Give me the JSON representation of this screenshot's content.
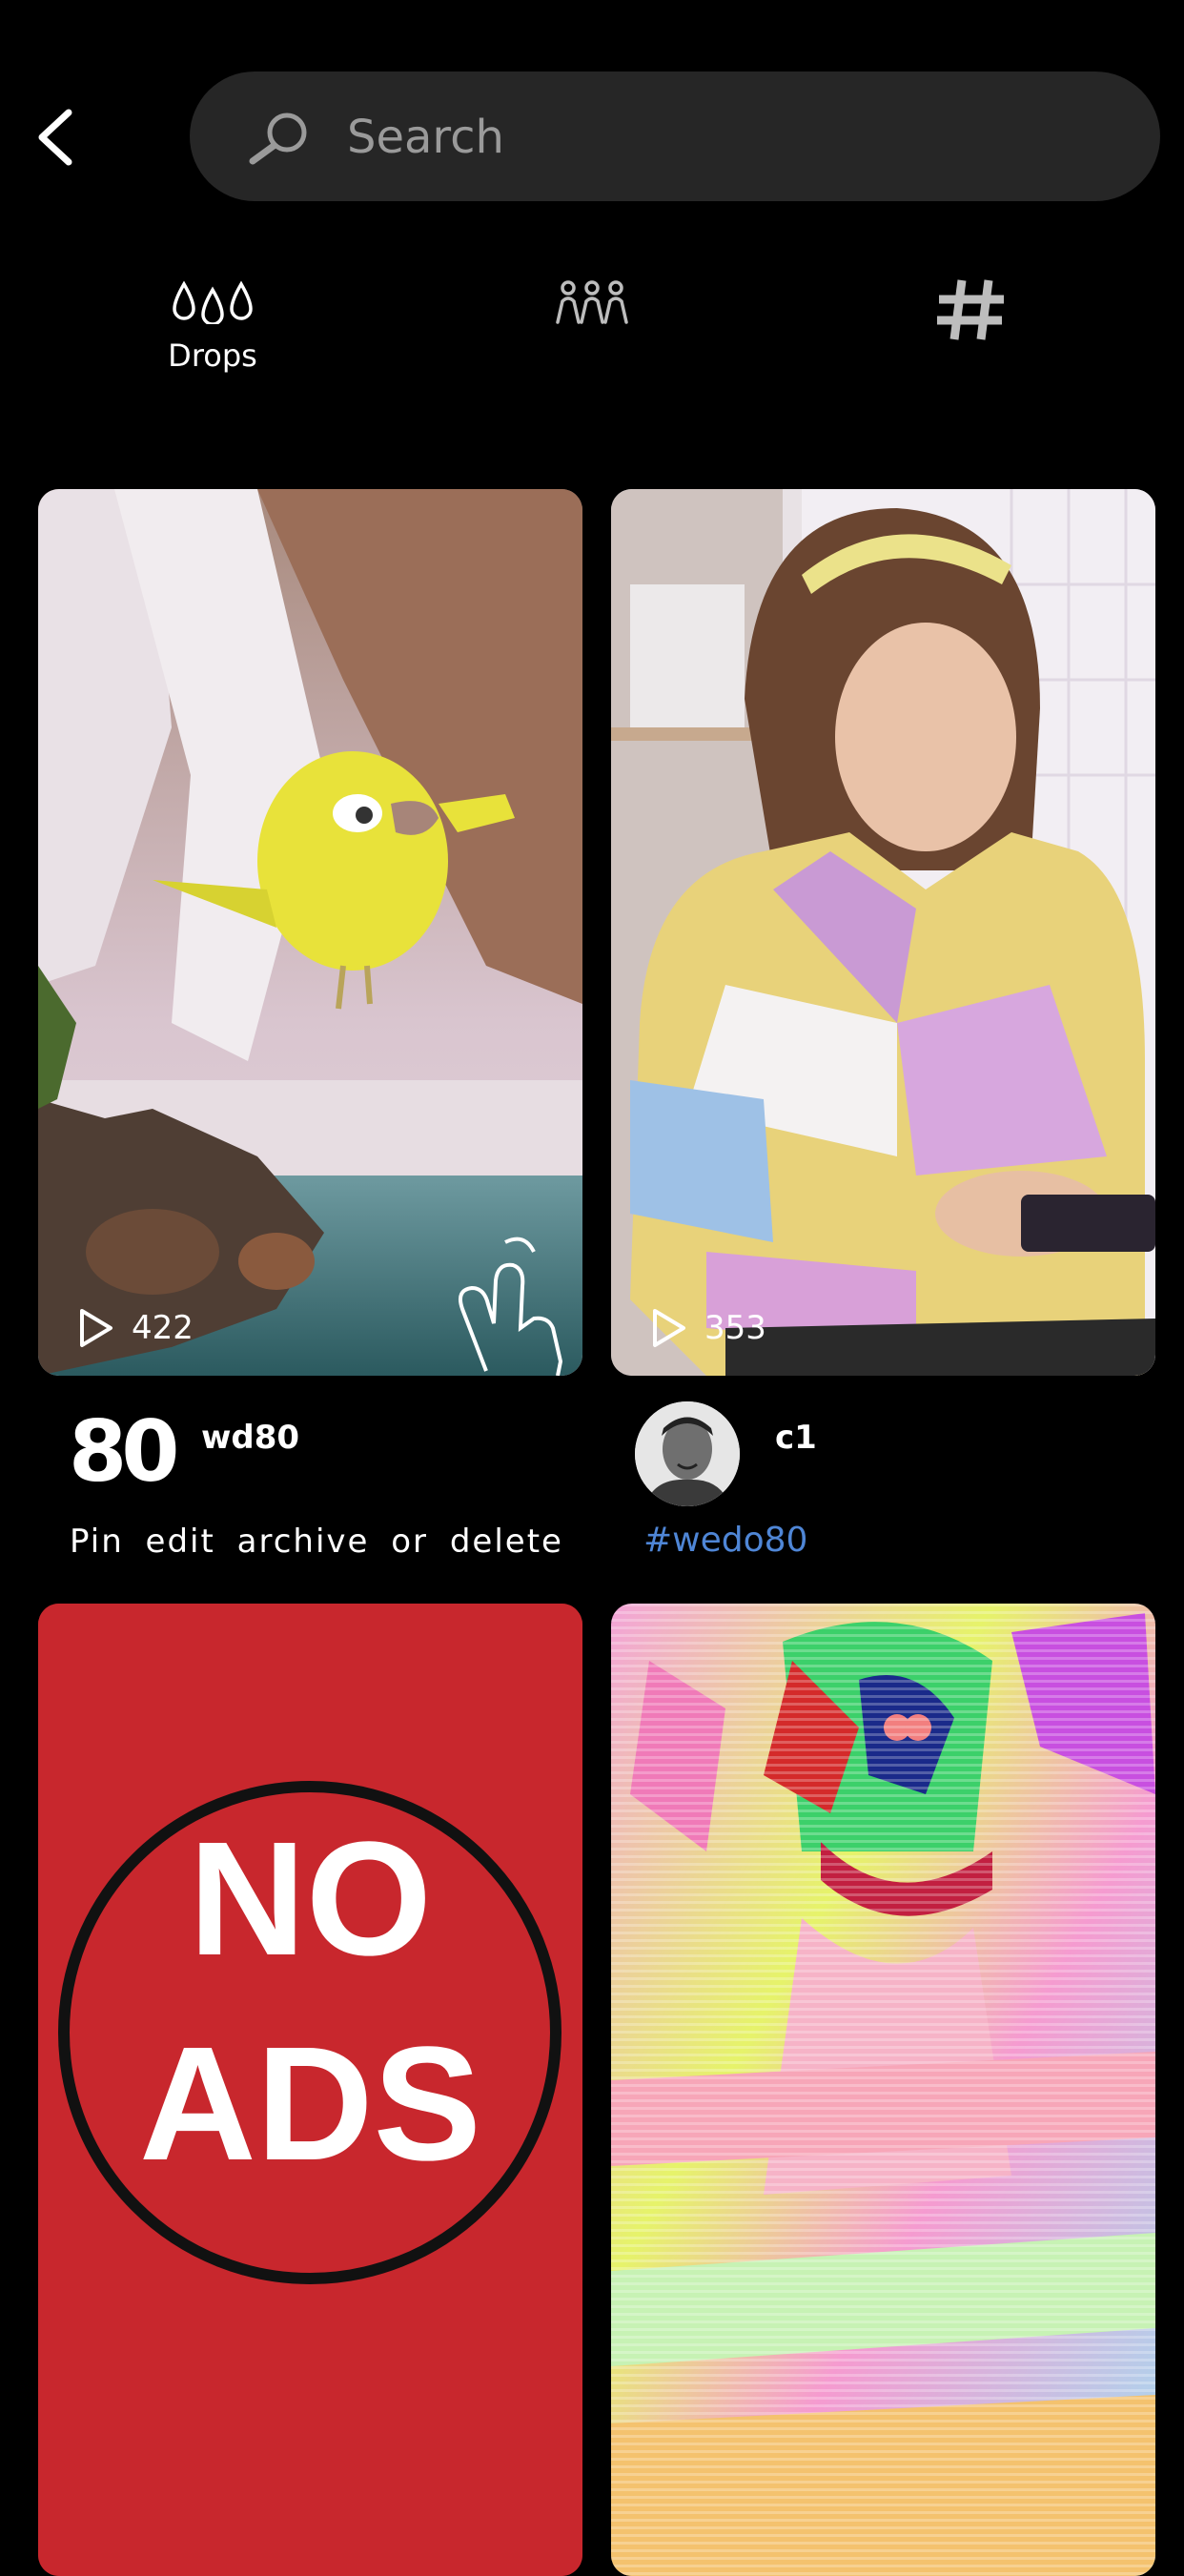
{
  "search": {
    "placeholder": "Search"
  },
  "tabs": [
    {
      "id": "drops",
      "label": "Drops",
      "icon": "drops-icon"
    },
    {
      "id": "people",
      "label": "",
      "icon": "people-group-icon"
    },
    {
      "id": "hashtags",
      "label": "",
      "icon": "hashtag-icon"
    }
  ],
  "posts": [
    {
      "views": "422",
      "username": "wd80",
      "caption": "Pin edit archive or delete",
      "avatar": "wedo80-logo",
      "avatar_text": "80"
    },
    {
      "views": "353",
      "username": "c1",
      "caption": "#wedo80",
      "avatar": "user-photo"
    },
    {
      "image_text": [
        "NO",
        "ADS"
      ]
    },
    {
      "image": "colorful-glitch-video"
    }
  ],
  "colors": {
    "background": "#000000",
    "search_bg": "#262626",
    "hashtag": "#4f86d6",
    "no_ads_red": "#c8272d"
  }
}
